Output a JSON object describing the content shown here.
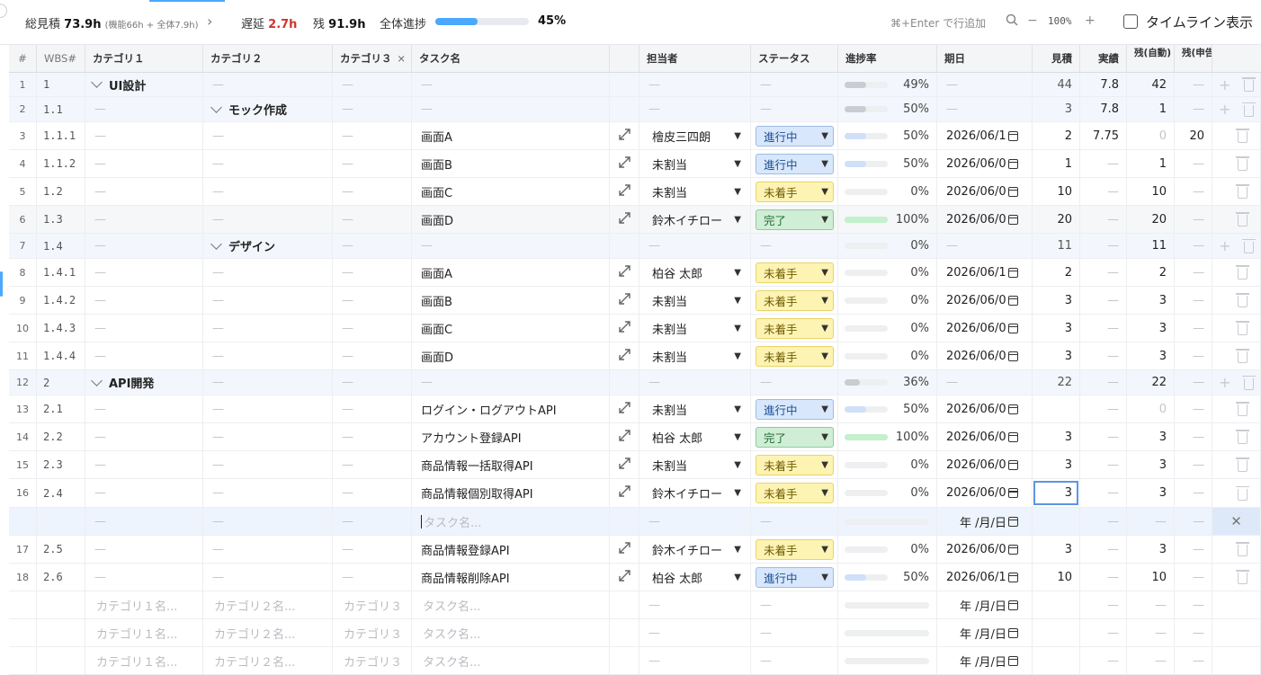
{
  "summary": {
    "total_label": "総見積",
    "total_value": "73.9h",
    "total_detail": "(機能66h + 全体7.9h)",
    "delay_label": "遅延",
    "delay_value": "2.7h",
    "remain_label": "残",
    "remain_value": "91.9h",
    "overall_label": "全体進捗",
    "overall_progress": 0.45,
    "overall_pct": "45%",
    "add_hint": "⌘+Enter で行追加",
    "zoom": "100%",
    "timeline_label": "タイムライン表示"
  },
  "headers": {
    "num": "#",
    "wbs": "WBS#",
    "cat1": "カテゴリ１",
    "cat2": "カテゴリ２",
    "cat3": "カテゴリ３",
    "task": "タスク名",
    "assignee": "担当者",
    "status": "ステータス",
    "progress": "進捗率",
    "due": "期日",
    "est": "見積",
    "act": "実績",
    "rem1": "残(自動)",
    "rem2": "残(申告)"
  },
  "dash": "—",
  "rows": [
    {
      "n": "1",
      "wbs": "1",
      "type": "group",
      "level": 1,
      "title": "UI設計",
      "progress": 0.49,
      "pct": "49%",
      "est": "44",
      "act": "7.8",
      "rem": "42",
      "rem2": "—"
    },
    {
      "n": "2",
      "wbs": "1.1",
      "type": "group",
      "level": 2,
      "title": "モック作成",
      "progress": 0.5,
      "pct": "50%",
      "est": "3",
      "act": "7.8",
      "rem": "1",
      "rem2": "—"
    },
    {
      "n": "3",
      "wbs": "1.1.1",
      "type": "task",
      "task": "画面A",
      "assignee": "檜皮三四朗",
      "status": "進行中",
      "progress": 0.5,
      "pct": "50%",
      "due": "2026/06/1",
      "est": "2",
      "act": "7.75",
      "rem": "0",
      "rem2": "20"
    },
    {
      "n": "4",
      "wbs": "1.1.2",
      "type": "task",
      "task": "画面B",
      "assignee": "未割当",
      "status": "進行中",
      "progress": 0.5,
      "pct": "50%",
      "due": "2026/06/0",
      "est": "1",
      "act": "—",
      "rem": "1",
      "rem2": "—"
    },
    {
      "n": "5",
      "wbs": "1.2",
      "type": "task",
      "task": "画面C",
      "assignee": "未割当",
      "status": "未着手",
      "progress": 0,
      "pct": "0%",
      "due": "2026/06/0",
      "est": "10",
      "act": "—",
      "rem": "10",
      "rem2": "—"
    },
    {
      "n": "6",
      "wbs": "1.3",
      "type": "task",
      "task": "画面D",
      "assignee": "鈴木イチロー",
      "status": "完了",
      "progress": 1,
      "pct": "100%",
      "due": "2026/06/0",
      "est": "20",
      "act": "—",
      "rem": "20",
      "rem2": "—"
    },
    {
      "n": "7",
      "wbs": "1.4",
      "type": "group",
      "level": 2,
      "title": "デザイン",
      "progress": 0,
      "pct": "0%",
      "est": "11",
      "act": "—",
      "rem": "11",
      "rem2": "—"
    },
    {
      "n": "8",
      "wbs": "1.4.1",
      "type": "task",
      "task": "画面A",
      "assignee": "柏谷 太郎",
      "status": "未着手",
      "progress": 0,
      "pct": "0%",
      "due": "2026/06/1",
      "est": "2",
      "act": "—",
      "rem": "2",
      "rem2": "—"
    },
    {
      "n": "9",
      "wbs": "1.4.2",
      "type": "task",
      "task": "画面B",
      "assignee": "未割当",
      "status": "未着手",
      "progress": 0,
      "pct": "0%",
      "due": "2026/06/0",
      "est": "3",
      "act": "—",
      "rem": "3",
      "rem2": "—"
    },
    {
      "n": "10",
      "wbs": "1.4.3",
      "type": "task",
      "task": "画面C",
      "assignee": "未割当",
      "status": "未着手",
      "progress": 0,
      "pct": "0%",
      "due": "2026/06/0",
      "est": "3",
      "act": "—",
      "rem": "3",
      "rem2": "—"
    },
    {
      "n": "11",
      "wbs": "1.4.4",
      "type": "task",
      "task": "画面D",
      "assignee": "未割当",
      "status": "未着手",
      "progress": 0,
      "pct": "0%",
      "due": "2026/06/0",
      "est": "3",
      "act": "—",
      "rem": "3",
      "rem2": "—"
    },
    {
      "n": "12",
      "wbs": "2",
      "type": "group",
      "level": 1,
      "title": "API開発",
      "progress": 0.36,
      "pct": "36%",
      "est": "22",
      "act": "—",
      "rem": "22",
      "rem2": "—"
    },
    {
      "n": "13",
      "wbs": "2.1",
      "type": "task",
      "task": "ログイン・ログアウトAPI",
      "assignee": "未割当",
      "status": "進行中",
      "progress": 0.5,
      "pct": "50%",
      "due": "2026/06/0",
      "est": "",
      "act": "—",
      "rem": "0",
      "rem2": "—"
    },
    {
      "n": "14",
      "wbs": "2.2",
      "type": "task",
      "task": "アカウント登録API",
      "assignee": "柏谷 太郎",
      "status": "完了",
      "progress": 1,
      "pct": "100%",
      "due": "2026/06/0",
      "est": "3",
      "act": "—",
      "rem": "3",
      "rem2": "—"
    },
    {
      "n": "15",
      "wbs": "2.3",
      "type": "task",
      "task": "商品情報一括取得API",
      "assignee": "未割当",
      "status": "未着手",
      "progress": 0,
      "pct": "0%",
      "due": "2026/06/0",
      "est": "3",
      "act": "—",
      "rem": "3",
      "rem2": "—"
    },
    {
      "n": "16",
      "wbs": "2.4",
      "type": "task",
      "task": "商品情報個別取得API",
      "assignee": "鈴木イチロー",
      "status": "未着手",
      "progress": 0,
      "pct": "0%",
      "due": "2026/06/0",
      "est": "3",
      "act": "—",
      "rem": "3",
      "rem2": "—",
      "focus": true
    },
    {
      "n": "",
      "wbs": "",
      "type": "insert",
      "task_placeholder": "タスク名...",
      "due": "年 /月/日"
    },
    {
      "n": "17",
      "wbs": "2.5",
      "type": "task",
      "task": "商品情報登録API",
      "assignee": "鈴木イチロー",
      "status": "未着手",
      "progress": 0,
      "pct": "0%",
      "due": "2026/06/0",
      "est": "3",
      "act": "—",
      "rem": "3",
      "rem2": "—"
    },
    {
      "n": "18",
      "wbs": "2.6",
      "type": "task",
      "task": "商品情報削除API",
      "assignee": "柏谷 太郎",
      "status": "進行中",
      "progress": 0.5,
      "pct": "50%",
      "due": "2026/06/1",
      "est": "10",
      "act": "—",
      "rem": "10",
      "rem2": "—"
    }
  ],
  "ghost_rows": {
    "cat1": "カテゴリ１名...",
    "cat2": "カテゴリ２名...",
    "cat3": "カテゴリ３",
    "task": "タスク名...",
    "date": "年 /月/日",
    "count": 3
  },
  "status_colors": {
    "進行中": {
      "bg": "#d8e7fb",
      "border": "#9dbde8",
      "text": "#1d4f94",
      "bar": "#cfe0f8"
    },
    "未着手": {
      "bg": "#fdf3b3",
      "border": "#e8d467",
      "text": "#6e5a00",
      "bar": "#eeeff1"
    },
    "完了": {
      "bg": "#cfeed5",
      "border": "#8fcb9b",
      "text": "#216b33",
      "bar": "#c4f0cc"
    }
  },
  "colors": {
    "accent": "#4aa8ff",
    "delay": "#d0342c",
    "group_bar": "#c9ccd1"
  }
}
